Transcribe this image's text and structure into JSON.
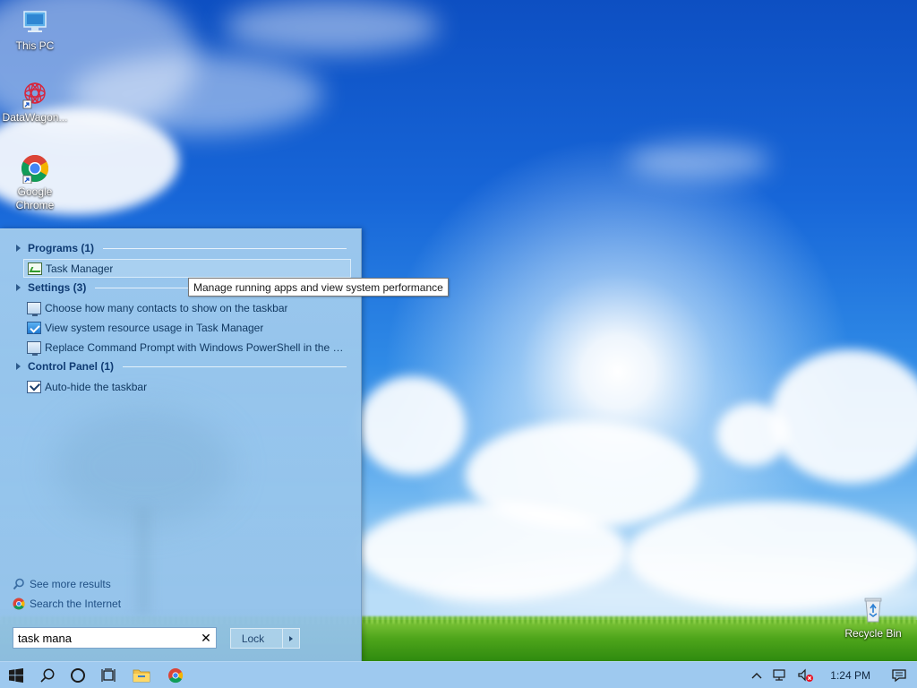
{
  "desktop": {
    "icons": [
      {
        "label": "This PC",
        "icon": "this-pc-icon"
      },
      {
        "label": "DataWagon...",
        "icon": "datawagon-icon"
      },
      {
        "label": "Google Chrome",
        "icon": "chrome-icon"
      },
      {
        "label": "Recycle Bin",
        "icon": "recycle-bin-icon"
      }
    ]
  },
  "start_menu": {
    "groups": [
      {
        "header": "Programs (1)"
      },
      {
        "header": "Settings (3)"
      },
      {
        "header": "Control Panel (1)"
      }
    ],
    "items": [
      {
        "label": "Task Manager",
        "icon": "task-manager-icon",
        "group": "Programs (1)",
        "highlighted": true
      },
      {
        "label": "Choose how many contacts to show on the taskbar",
        "icon": "monitor-icon",
        "group": "Settings (3)"
      },
      {
        "label": "View system resource usage in Task Manager",
        "icon": "system-resource-icon",
        "group": "Settings (3)"
      },
      {
        "label": "Replace Command Prompt with Windows PowerShell in the W...",
        "icon": "monitor-icon",
        "group": "Settings (3)"
      },
      {
        "label": "Auto-hide the taskbar",
        "icon": "taskbar-settings-icon",
        "group": "Control Panel (1)"
      }
    ],
    "see_more": "See more results",
    "search_internet": "Search the Internet",
    "search": {
      "value": "task mana",
      "placeholder": ""
    },
    "power_button": "Lock"
  },
  "tooltip": "Manage running apps and view system performance",
  "taskbar": {
    "buttons": [
      "start-icon",
      "search-icon",
      "cortana-icon",
      "task-view-icon",
      "file-explorer-icon",
      "chrome-icon"
    ],
    "clock": "1:24 PM"
  },
  "colors": {
    "start_menu_bg": "#a4cdee",
    "taskbar_bg": "#9ec9ef",
    "group_header": "#0f3b73",
    "link_text": "#1f4f84"
  }
}
